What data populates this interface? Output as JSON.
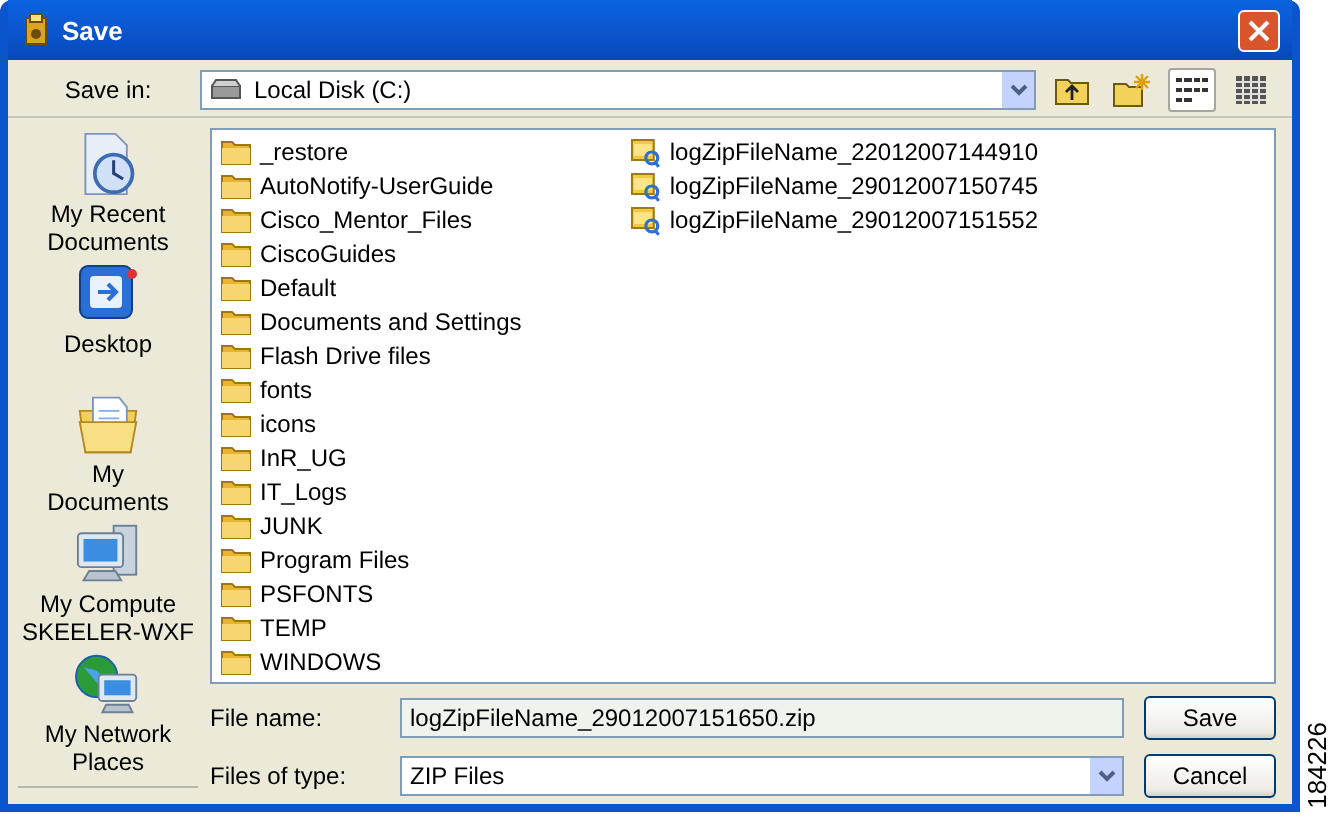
{
  "window": {
    "title": "Save"
  },
  "save_in": {
    "label": "Save in:",
    "value": "Local Disk (C:)"
  },
  "toolbar": [
    {
      "kind": "up-folder",
      "selected": false
    },
    {
      "kind": "new-folder",
      "selected": false
    },
    {
      "kind": "view-menu",
      "selected": true
    },
    {
      "kind": "details",
      "selected": false
    }
  ],
  "places": [
    {
      "kind": "recent",
      "lines": [
        "My Recent",
        "Documents"
      ]
    },
    {
      "kind": "desktop",
      "lines": [
        "Desktop"
      ]
    },
    {
      "kind": "documents",
      "lines": [
        "My",
        "Documents"
      ]
    },
    {
      "kind": "computer",
      "lines": [
        "My Compute",
        "SKEELER-WXF"
      ]
    },
    {
      "kind": "network",
      "lines": [
        "My Network",
        "Places"
      ]
    }
  ],
  "files": [
    {
      "kind": "folder",
      "name": "_restore"
    },
    {
      "kind": "folder",
      "name": "AutoNotify-UserGuide"
    },
    {
      "kind": "folder",
      "name": "Cisco_Mentor_Files"
    },
    {
      "kind": "folder",
      "name": "CiscoGuides"
    },
    {
      "kind": "folder",
      "name": "Default"
    },
    {
      "kind": "folder",
      "name": "Documents and Settings"
    },
    {
      "kind": "folder",
      "name": "Flash Drive files"
    },
    {
      "kind": "folder",
      "name": "fonts"
    },
    {
      "kind": "folder",
      "name": "icons"
    },
    {
      "kind": "folder",
      "name": "InR_UG"
    },
    {
      "kind": "folder",
      "name": "IT_Logs"
    },
    {
      "kind": "folder",
      "name": "JUNK"
    },
    {
      "kind": "folder",
      "name": "Program Files"
    },
    {
      "kind": "folder",
      "name": "PSFONTS"
    },
    {
      "kind": "folder",
      "name": "TEMP"
    },
    {
      "kind": "folder",
      "name": "WINDOWS"
    },
    {
      "kind": "zip",
      "name": "logZipFileName_22012007144910"
    },
    {
      "kind": "zip",
      "name": "logZipFileName_29012007150745"
    },
    {
      "kind": "zip",
      "name": "logZipFileName_29012007151552"
    }
  ],
  "file_name": {
    "label": "File name:",
    "value": "logZipFileName_29012007151650.zip"
  },
  "file_type": {
    "label": "Files of type:",
    "value": "ZIP Files"
  },
  "buttons": [
    "Save",
    "Cancel"
  ],
  "figure_number": "184226"
}
